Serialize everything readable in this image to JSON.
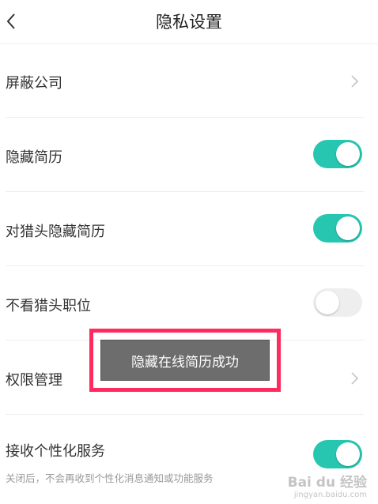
{
  "header": {
    "title": "隐私设置",
    "back_icon": "chevron-left-icon"
  },
  "settings": [
    {
      "label": "屏蔽公司",
      "control": "chevron",
      "icon": "chevron-right-icon"
    },
    {
      "label": "隐藏简历",
      "control": "toggle",
      "state": "on"
    },
    {
      "label": "对猎头隐藏简历",
      "control": "toggle",
      "state": "on"
    },
    {
      "label": "不看猎头职位",
      "control": "toggle",
      "state": "off"
    },
    {
      "label": "权限管理",
      "control": "chevron",
      "icon": "chevron-right-icon"
    },
    {
      "label": "接收个性化服务",
      "control": "toggle",
      "state": "on",
      "subtext": "关闭后，不会再收到个性化消息通知或功能服务"
    }
  ],
  "toast": {
    "message": "隐藏在线简历成功"
  },
  "watermark": {
    "main": "Bai du 经验",
    "sub": "jingyan.baidu.com"
  },
  "colors": {
    "toggle_on": "#26c6b0",
    "toggle_off": "#eeeeee",
    "highlight_border": "#ff2a5f",
    "toast_bg": "#6d6d6d"
  }
}
